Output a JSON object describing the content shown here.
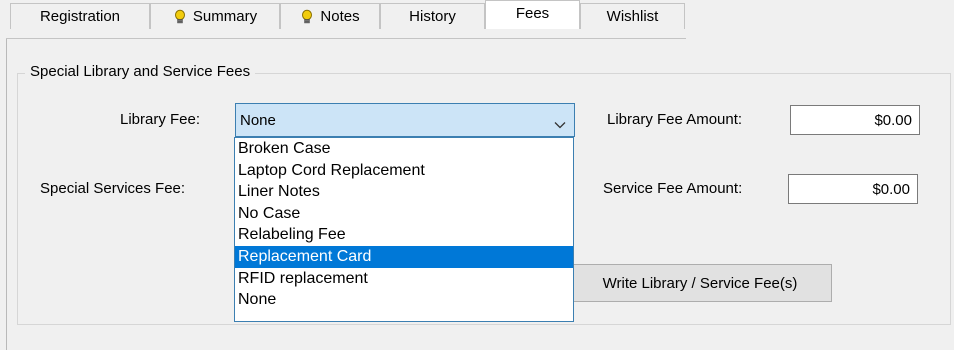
{
  "tabs": [
    {
      "label": "Registration",
      "icon": "",
      "active": false
    },
    {
      "label": "Summary",
      "icon": "lightbulb-icon",
      "active": false
    },
    {
      "label": "Notes",
      "icon": "lightbulb-icon",
      "active": false
    },
    {
      "label": "History",
      "icon": "",
      "active": false
    },
    {
      "label": "Fees",
      "icon": "",
      "active": true
    },
    {
      "label": "Wishlist",
      "icon": "",
      "active": false
    }
  ],
  "group": {
    "title": "Special Library and Service Fees"
  },
  "library_fee": {
    "label": "Library Fee:",
    "value": "None",
    "amount_label": "Library Fee Amount:",
    "amount": "$0.00"
  },
  "service_fee": {
    "label": "Special Services Fee:",
    "amount_label": "Service Fee Amount:",
    "amount": "$0.00"
  },
  "write_button": {
    "label": "Write Library / Service Fee(s)"
  },
  "dropdown": {
    "options": [
      "Broken Case",
      "Laptop Cord Replacement",
      "Liner Notes",
      "No Case",
      "Relabeling Fee",
      "Replacement Card",
      "RFID replacement",
      "None"
    ],
    "highlighted": "Replacement Card"
  },
  "colors": {
    "background": "#f0f0f0",
    "combo_focus": "#cce4f7",
    "selection": "#0078d7",
    "lightbulb": "#f2cc0c"
  }
}
